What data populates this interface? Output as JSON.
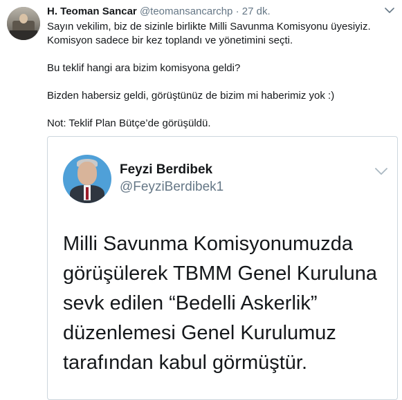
{
  "tweet": {
    "author_name": "H. Teoman Sancar",
    "handle": "@teomansancarchp",
    "separator": "·",
    "time": "27 dk.",
    "lines": [
      "Sayın vekilim, biz de sizinle birlikte Milli Savunma Komisyonu üyesiyiz. Komisyon sadece bir kez toplandı ve yönetimini seçti.",
      "Bu teklif hangi ara bizim komisyona geldi?",
      "Bizden habersiz geldi, görüştünüz de bizim mi haberimiz yok :)",
      "Not: Teklif Plan Bütçe’de görüşüldü."
    ]
  },
  "quoted": {
    "author_name": "Feyzi Berdibek",
    "handle": "@FeyziBerdibek1",
    "text": "Milli Savunma Komisyonumuzda görüşülerek TBMM Genel Kuruluna sevk edilen “Bedelli Askerlik” düzenlemesi Genel Kurulumuz tarafından kabul görmüştür."
  },
  "icons": {
    "menu": "chevron-down-icon",
    "avatar": "avatar"
  },
  "colors": {
    "text": "#14171a",
    "secondary": "#657786",
    "border": "#ccd6dd",
    "quoted_avatar_bg": "#4fa0d8"
  }
}
